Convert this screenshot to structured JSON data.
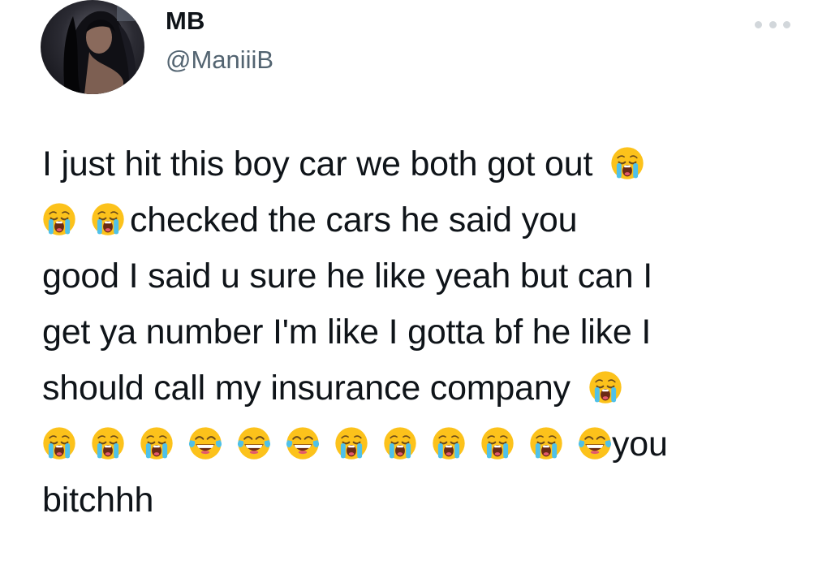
{
  "user": {
    "display_name": "MB",
    "handle": "@ManiiiB"
  },
  "more_icon": "more-horizontal-icon",
  "tweet": {
    "line1": "I just hit this boy car we both got out",
    "line2": "checked the cars he said you",
    "line3": "good I said u sure he like yeah but can I",
    "line4": "get ya number I'm like I gotta bf he like I",
    "line5": "should call my insurance company",
    "line6": "you",
    "line7": "bitchhh"
  },
  "emojis": {
    "crying": "loudly-crying-face",
    "laughing": "face-with-tears-of-joy"
  },
  "colors": {
    "text": "#0f1419",
    "secondary": "#536471",
    "emoji_face": "#fcc21b",
    "tears": "#4fc1e9"
  }
}
